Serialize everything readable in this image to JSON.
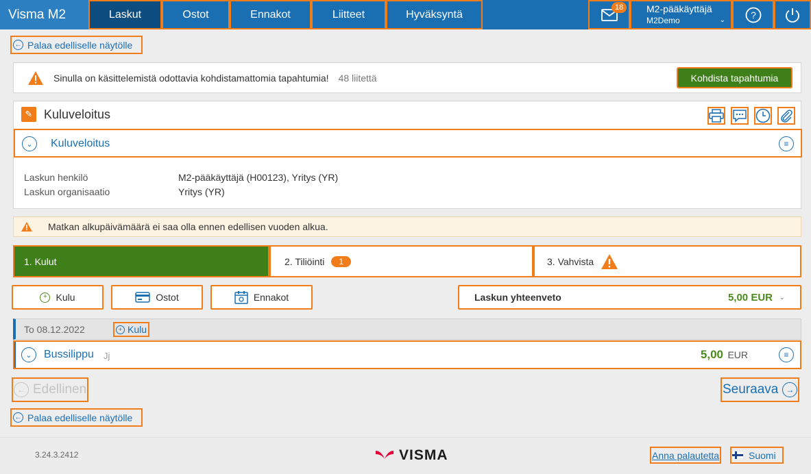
{
  "nav": {
    "brand": "Visma M2",
    "tabs": [
      {
        "label": "Laskut"
      },
      {
        "label": "Ostot"
      },
      {
        "label": "Ennakot"
      },
      {
        "label": "Liitteet"
      },
      {
        "label": "Hyväksyntä"
      }
    ],
    "mail_badge": "18",
    "user_name": "M2-pääkäyttäjä",
    "user_org": "M2Demo"
  },
  "back_link": "Palaa edelliselle näytölle",
  "notice": {
    "text": "Sinulla on käsittelemistä odottavia kohdistamattomia tapahtumia!",
    "count": "48 liitettä",
    "button": "Kohdista tapahtumia"
  },
  "invoice": {
    "title": "Kuluveloitus",
    "subtitle": "Kuluveloitus",
    "fields": [
      {
        "label": "Laskun henkilö",
        "value": "M2-pääkäyttäjä (H00123), Yritys (YR)"
      },
      {
        "label": "Laskun organisaatio",
        "value": "Yritys (YR)"
      }
    ]
  },
  "warning": "Matkan alkupäivämäärä ei saa olla ennen edellisen vuoden alkua.",
  "steps": [
    {
      "label": "1. Kulut",
      "badge": ""
    },
    {
      "label": "2. Tiliöinti",
      "badge": "1"
    },
    {
      "label": "3. Vahvista",
      "badge": ""
    }
  ],
  "actions": {
    "kulu": "Kulu",
    "ostot": "Ostot",
    "ennakot": "Ennakot"
  },
  "summary": {
    "label": "Laskun yhteenveto",
    "amount": "5,00 EUR"
  },
  "expense_group": {
    "date": "To 08.12.2022",
    "add": "Kulu",
    "item_name": "Bussilippu",
    "item_sub": "Jj",
    "item_amount": "5,00",
    "item_currency": "EUR"
  },
  "pager": {
    "prev": "Edellinen",
    "next": "Seuraava"
  },
  "footer": {
    "version": "3.24.3.2412",
    "logo": "VISMA",
    "feedback": "Anna palautetta",
    "language": "Suomi"
  },
  "colors": {
    "nav_bg": "#1a6fb3",
    "active_tab": "#0e4d80",
    "accent_orange": "#f07d1a",
    "green": "#3f7f1a",
    "logo_red": "#e3003b"
  }
}
